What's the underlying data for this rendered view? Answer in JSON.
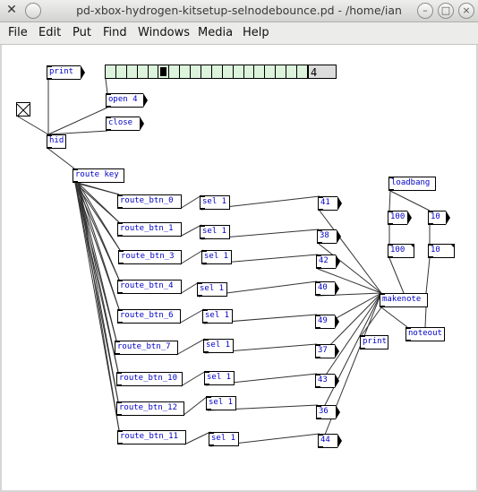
{
  "window": {
    "title": "pd-xbox-hydrogen-kitsetup-selnodebounce.pd  - /home/ian",
    "close_glyph": "×",
    "app_glyph": "✕",
    "min_glyph": "–",
    "max_glyph": "□"
  },
  "menu": [
    "File",
    "Edit",
    "Put",
    "Find",
    "Windows",
    "Media",
    "Help"
  ],
  "radio": {
    "cells": 19,
    "selected": 5,
    "value": "4"
  },
  "objects": [
    {
      "id": "print1",
      "text": "print",
      "type": "msg"
    },
    {
      "id": "open4",
      "text": "open 4",
      "type": "msg"
    },
    {
      "id": "close",
      "text": "close",
      "type": "msg"
    },
    {
      "id": "hid",
      "text": "hid",
      "type": "obj"
    },
    {
      "id": "routekey",
      "text": "route key",
      "type": "obj"
    },
    {
      "id": "rb0",
      "text": "route_btn_0",
      "type": "obj"
    },
    {
      "id": "rb1",
      "text": "route_btn_1",
      "type": "obj"
    },
    {
      "id": "rb3",
      "text": "route_btn_3",
      "type": "obj"
    },
    {
      "id": "rb4",
      "text": "route_btn_4",
      "type": "obj"
    },
    {
      "id": "rb6",
      "text": "route_btn_6",
      "type": "obj"
    },
    {
      "id": "rb7",
      "text": "route_btn_7",
      "type": "obj"
    },
    {
      "id": "rb10",
      "text": "route_btn_10",
      "type": "obj"
    },
    {
      "id": "rb12",
      "text": "route_btn_12",
      "type": "obj"
    },
    {
      "id": "rb11",
      "text": "route_btn_11",
      "type": "obj"
    },
    {
      "id": "s0",
      "text": "sel 1",
      "type": "obj"
    },
    {
      "id": "s1",
      "text": "sel 1",
      "type": "obj"
    },
    {
      "id": "s3",
      "text": "sel 1",
      "type": "obj"
    },
    {
      "id": "s4",
      "text": "sel 1",
      "type": "obj"
    },
    {
      "id": "s6",
      "text": "sel 1",
      "type": "obj"
    },
    {
      "id": "s7",
      "text": "sel 1",
      "type": "obj"
    },
    {
      "id": "s10",
      "text": "sel 1",
      "type": "obj"
    },
    {
      "id": "s12",
      "text": "sel 1",
      "type": "obj"
    },
    {
      "id": "s11",
      "text": "sel 1",
      "type": "obj"
    },
    {
      "id": "m41",
      "text": "41",
      "type": "msg"
    },
    {
      "id": "m38",
      "text": "38",
      "type": "msg"
    },
    {
      "id": "m42",
      "text": "42",
      "type": "msg"
    },
    {
      "id": "m40",
      "text": "40",
      "type": "msg"
    },
    {
      "id": "m49",
      "text": "49",
      "type": "msg"
    },
    {
      "id": "m37",
      "text": "37",
      "type": "msg"
    },
    {
      "id": "m43",
      "text": "43",
      "type": "msg"
    },
    {
      "id": "m36",
      "text": "36",
      "type": "msg"
    },
    {
      "id": "m44",
      "text": "44",
      "type": "msg"
    },
    {
      "id": "loadbang",
      "text": "loadbang",
      "type": "obj"
    },
    {
      "id": "m100",
      "text": "100",
      "type": "msg"
    },
    {
      "id": "m10",
      "text": "10",
      "type": "msg"
    },
    {
      "id": "n100",
      "text": "100",
      "type": "num"
    },
    {
      "id": "n10",
      "text": "10",
      "type": "num"
    },
    {
      "id": "makenote",
      "text": "makenote",
      "type": "obj"
    },
    {
      "id": "print2",
      "text": "print",
      "type": "obj"
    },
    {
      "id": "noteout",
      "text": "noteout",
      "type": "obj"
    }
  ]
}
